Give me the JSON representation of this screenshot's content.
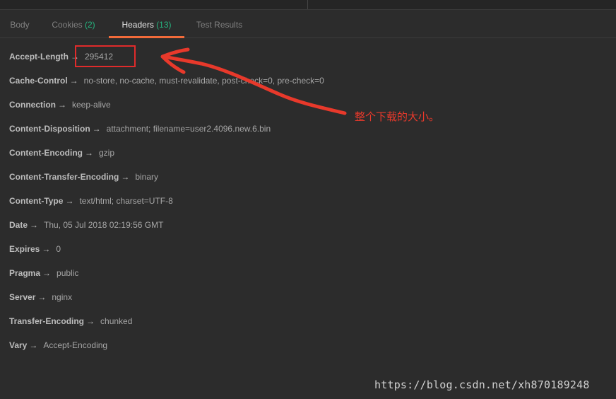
{
  "tabs": [
    {
      "label": "Body",
      "count": ""
    },
    {
      "label": "Cookies",
      "count": "(2)"
    },
    {
      "label": "Headers",
      "count": "(13)"
    },
    {
      "label": "Test Results",
      "count": ""
    }
  ],
  "active_tab": "Headers",
  "arrow_glyph": "→",
  "headers": [
    {
      "key": "Accept-Length",
      "value": "295412"
    },
    {
      "key": "Cache-Control",
      "value": "no-store, no-cache, must-revalidate, post-check=0, pre-check=0"
    },
    {
      "key": "Connection",
      "value": "keep-alive"
    },
    {
      "key": "Content-Disposition",
      "value": "attachment; filename=user2.4096.new.6.bin"
    },
    {
      "key": "Content-Encoding",
      "value": "gzip"
    },
    {
      "key": "Content-Transfer-Encoding",
      "value": "binary"
    },
    {
      "key": "Content-Type",
      "value": "text/html; charset=UTF-8"
    },
    {
      "key": "Date",
      "value": "Thu, 05 Jul 2018 02:19:56 GMT"
    },
    {
      "key": "Expires",
      "value": "0"
    },
    {
      "key": "Pragma",
      "value": "public"
    },
    {
      "key": "Server",
      "value": "nginx"
    },
    {
      "key": "Transfer-Encoding",
      "value": "chunked"
    },
    {
      "key": "Vary",
      "value": "Accept-Encoding"
    }
  ],
  "annotation": {
    "text": "整个下载的大小。",
    "color": "#e8392b"
  },
  "watermark": "https://blog.csdn.net/xh870189248",
  "colors": {
    "background": "#2c2c2c",
    "active_tab_underline": "#f26b3a",
    "count_green": "#26b47f"
  }
}
